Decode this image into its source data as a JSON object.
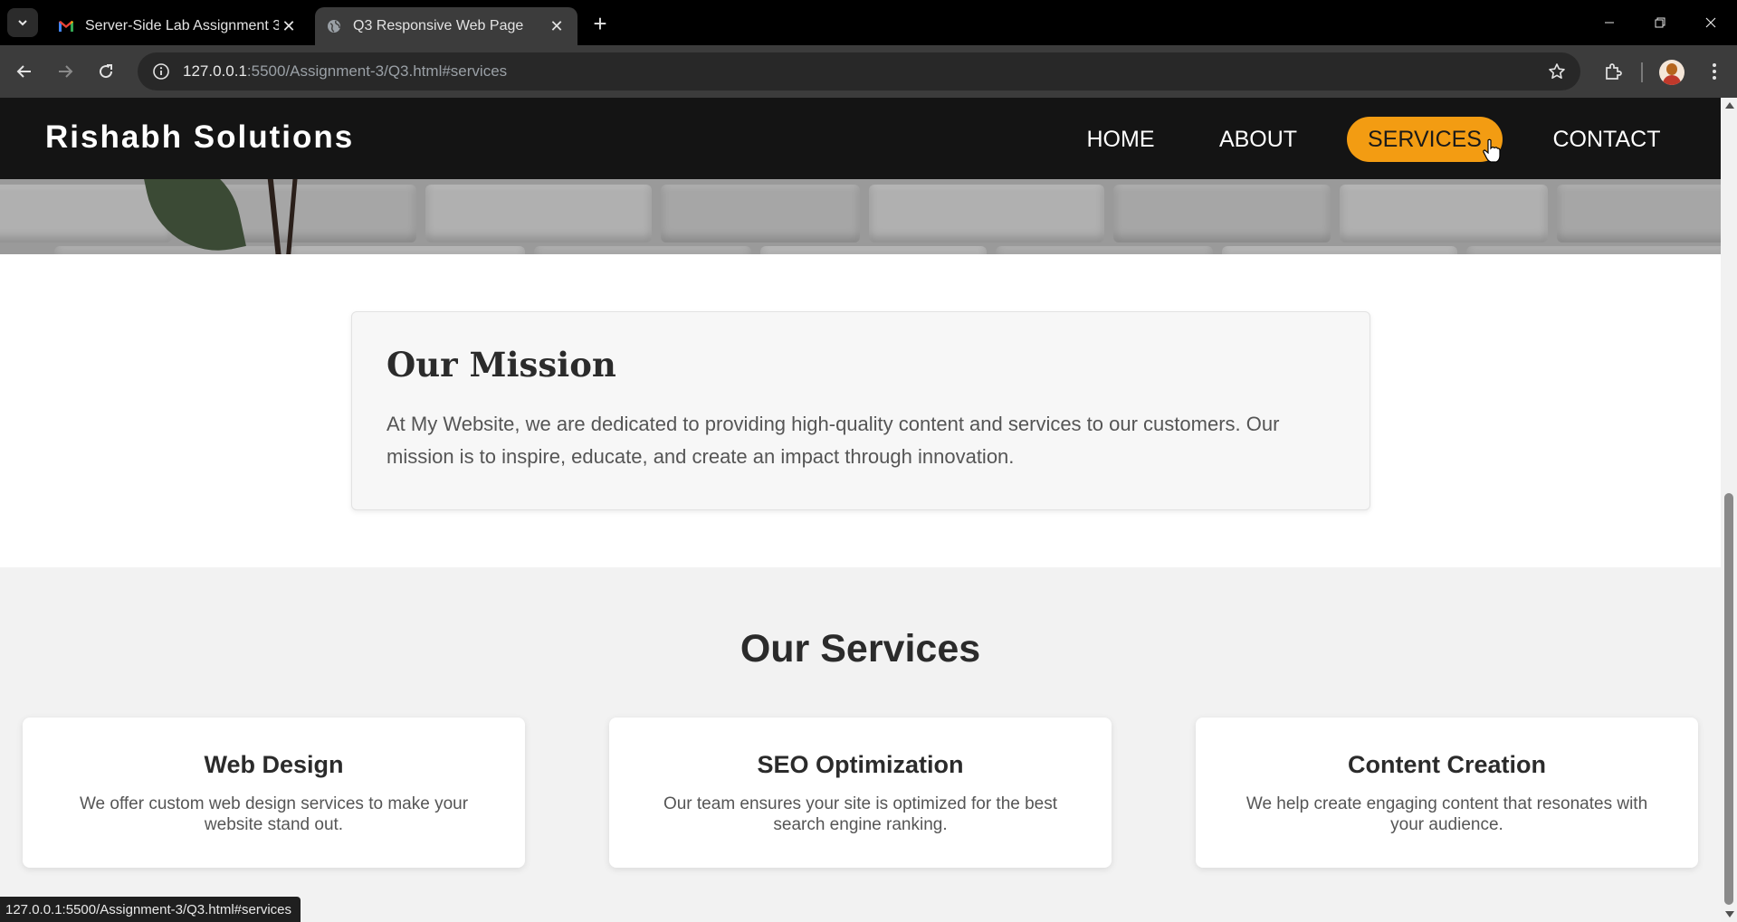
{
  "browser": {
    "tabs": [
      {
        "title": "Server-Side Lab Assignment 3 -",
        "favicon": "gmail-icon",
        "active": false
      },
      {
        "title": "Q3 Responsive Web Page",
        "favicon": "globe-icon",
        "active": true
      }
    ],
    "address": {
      "host": "127.0.0.1",
      "rest": ":5500/Assignment-3/Q3.html#services"
    },
    "status_url": "127.0.0.1:5500/Assignment-3/Q3.html#services"
  },
  "site": {
    "brand": "Rishabh Solutions",
    "nav": [
      {
        "label": "HOME"
      },
      {
        "label": "ABOUT"
      },
      {
        "label": "SERVICES",
        "active": true
      },
      {
        "label": "CONTACT"
      }
    ],
    "accent_color": "#f39c12",
    "header_color": "#141414"
  },
  "mission": {
    "title": "Our Mission",
    "text": "At My Website, we are dedicated to providing high-quality content and services to our customers. Our mission is to inspire, educate, and create an impact through innovation."
  },
  "services": {
    "heading": "Our Services",
    "items": [
      {
        "title": "Web Design",
        "text": "We offer custom web design services to make your website stand out."
      },
      {
        "title": "SEO Optimization",
        "text": "Our team ensures your site is optimized for the best search engine ranking."
      },
      {
        "title": "Content Creation",
        "text": "We help create engaging content that resonates with your audience."
      }
    ]
  }
}
